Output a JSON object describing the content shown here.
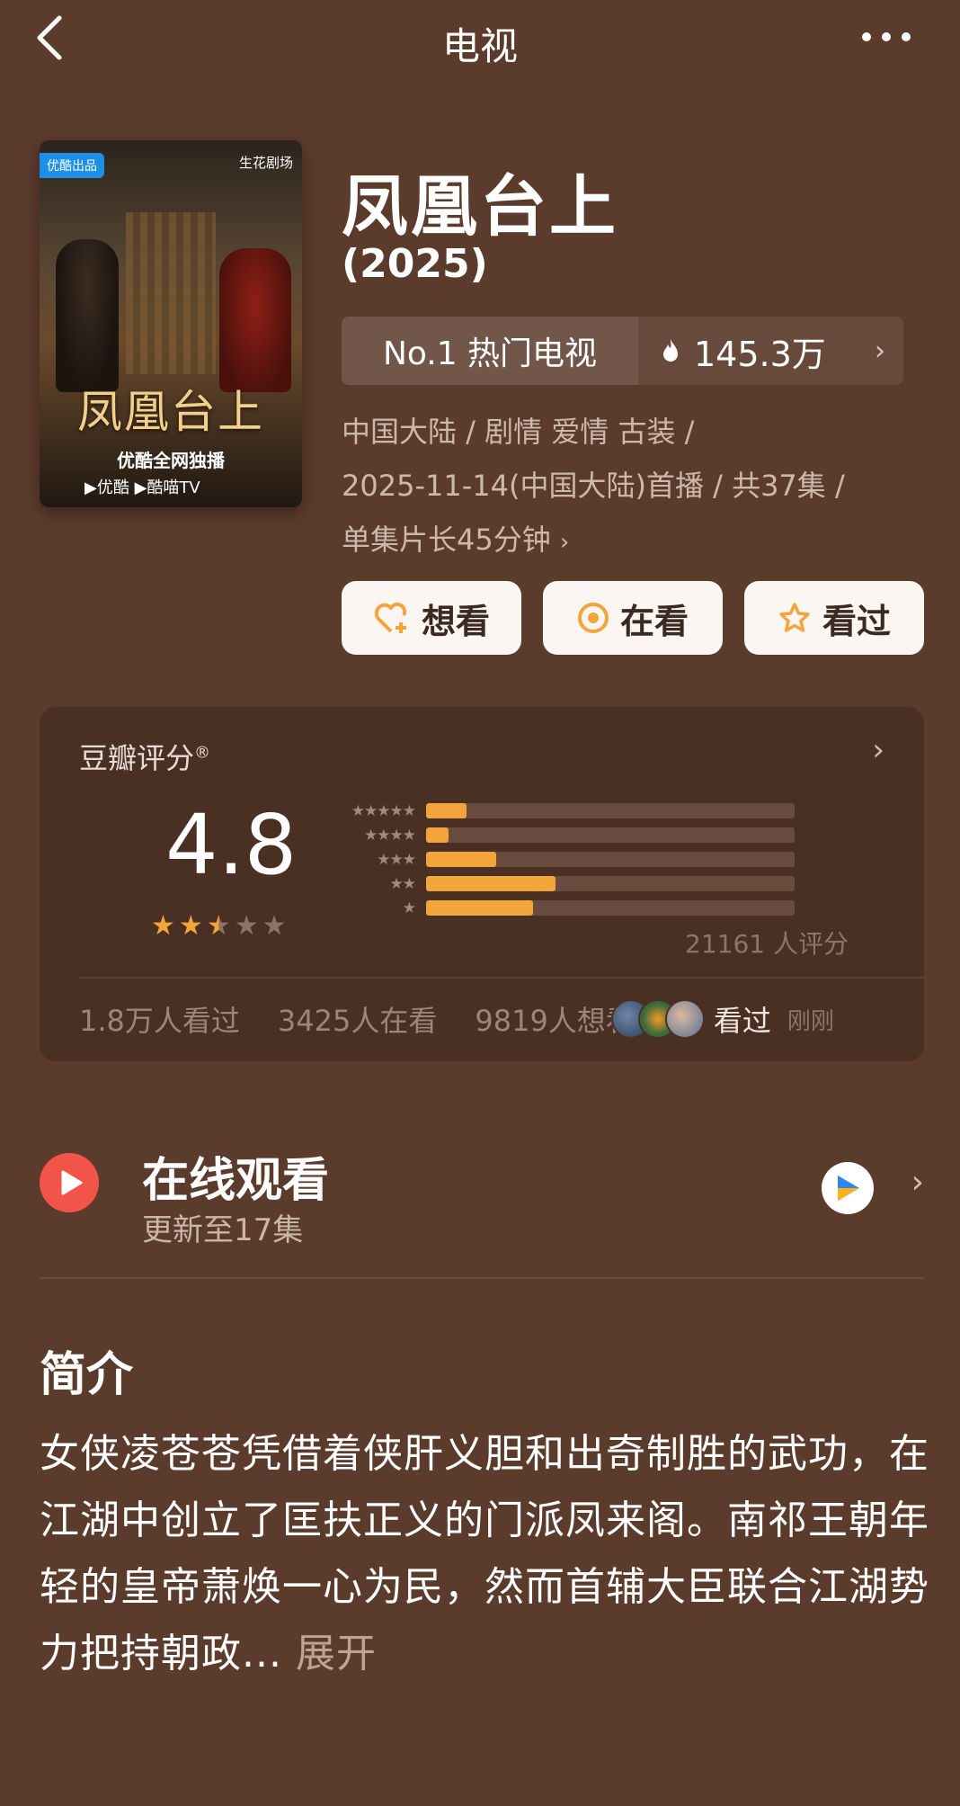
{
  "header": {
    "title": "电视"
  },
  "poster": {
    "tag_left": "优酷出品",
    "tag_right": "生花剧场",
    "title": "凤凰台上",
    "slogan": "优酷全网独播",
    "platforms": "▶优酷  ▶酷喵TV"
  },
  "show": {
    "title": "凤凰台上",
    "year": "(2025)",
    "rank_label": "No.1 热门电视",
    "hot_value": "145.3万",
    "meta_line1": "中国大陆 / 剧情 爱情 古装 /",
    "meta_line2": "2025-11-14(中国大陆)首播 / 共37集 /",
    "meta_line3": "单集片长45分钟"
  },
  "actions": {
    "want": "想看",
    "watching": "在看",
    "watched": "看过"
  },
  "rating": {
    "label": "豆瓣评分",
    "mark": "®",
    "score": "4.8",
    "stars_filled": 2.5,
    "distribution": [
      {
        "stars": "★★★★★",
        "ratio": 0.11
      },
      {
        "stars": "★★★★",
        "ratio": 0.06
      },
      {
        "stars": "★★★",
        "ratio": 0.19
      },
      {
        "stars": "★★",
        "ratio": 0.35
      },
      {
        "stars": "★",
        "ratio": 0.29
      }
    ],
    "count": "21161 人评分",
    "stats": {
      "watched": "1.8万人看过",
      "watching": "3425人在看",
      "want": "9819人想看",
      "friend_action": "看过",
      "time": "刚刚"
    }
  },
  "online": {
    "title": "在线观看",
    "subtitle": "更新至17集"
  },
  "intro": {
    "heading": "简介",
    "text": "女侠凌苍苍凭借着侠肝义胆和出奇制胜的武功，在江湖中创立了匡扶正义的门派凤来阁。南祁王朝年轻的皇帝萧焕一心为民，然而首辅大臣联合江湖势力把持朝政...",
    "expand": "展开"
  },
  "colors": {
    "background": "#5b3b2c",
    "card": "#4a2f23",
    "accent_star": "#f3a43b",
    "play_red": "#f2544a"
  }
}
